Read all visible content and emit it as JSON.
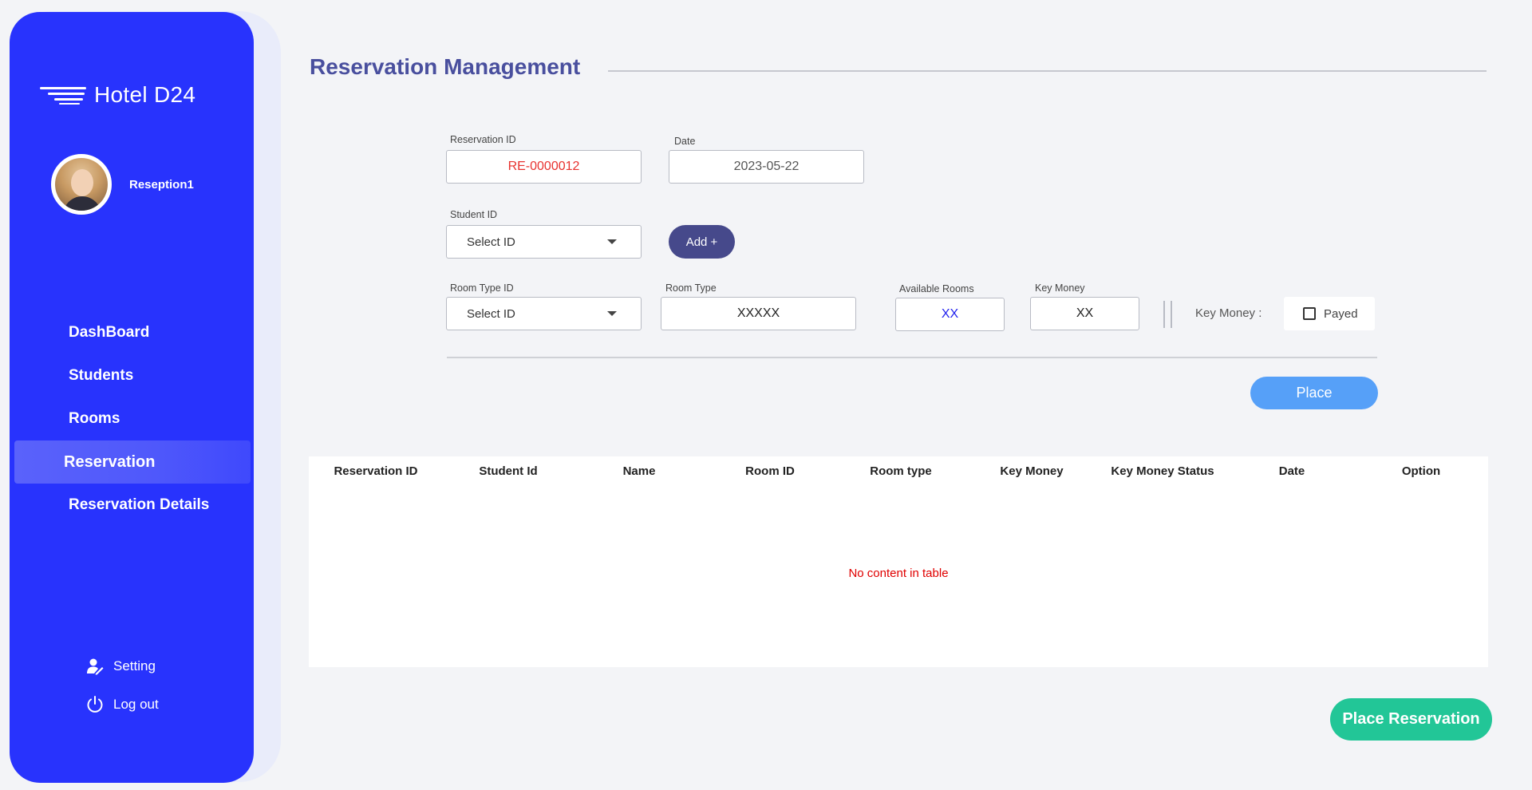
{
  "app": {
    "name": "Hotel D24"
  },
  "profile": {
    "name": "Reseption1"
  },
  "nav": {
    "items": [
      {
        "label": "DashBoard"
      },
      {
        "label": "Students"
      },
      {
        "label": "Rooms"
      },
      {
        "label": "Reservation",
        "active": true
      },
      {
        "label": "Reservation Details"
      }
    ]
  },
  "bottom": {
    "setting": "Setting",
    "logout": "Log out"
  },
  "page": {
    "title": "Reservation Management"
  },
  "form": {
    "reservation_id": {
      "label": "Reservation ID",
      "value": "RE-0000012"
    },
    "date": {
      "label": "Date",
      "value": "2023-05-22"
    },
    "student_id": {
      "label": "Student ID",
      "value": "Select ID"
    },
    "add_button": "Add +",
    "room_type_id": {
      "label": "Room Type ID",
      "value": "Select ID"
    },
    "room_type": {
      "label": "Room Type",
      "value": "XXXXX"
    },
    "available_rooms": {
      "label": "Available Rooms",
      "value": "XX"
    },
    "key_money": {
      "label": "Key Money",
      "value": "XX"
    },
    "key_money_status_label": "Key Money :",
    "payed_label": "Payed",
    "payed_checked": false,
    "place_button": "Place"
  },
  "table": {
    "columns": [
      "Reservation ID",
      "Student Id",
      "Name",
      "Room ID",
      "Room type",
      "Key Money",
      "Key Money Status",
      "Date",
      "Option"
    ],
    "rows": [],
    "empty_text": "No content in table"
  },
  "actions": {
    "place_reservation": "Place Reservation"
  },
  "colors": {
    "sidebar": "#2833fd",
    "title": "#494f9e",
    "add_button": "#46498b",
    "place_button": "#56a0f8",
    "place_reservation_button": "#22c697",
    "reservation_id_text": "#e8322f",
    "available_rooms_text": "#2222ee",
    "empty_text": "#e00000"
  }
}
